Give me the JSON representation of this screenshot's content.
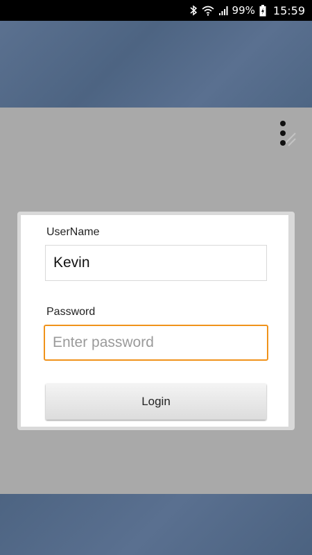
{
  "status_bar": {
    "battery": "99%",
    "time": "15:59",
    "icons": [
      "bluetooth-icon",
      "wifi-icon",
      "signal-icon",
      "battery-charging-icon"
    ]
  },
  "menu": {
    "icon": "overflow-menu-icon"
  },
  "login_form": {
    "username_label": "UserName",
    "username_value": "Kevin",
    "password_label": "Password",
    "password_value": "",
    "password_placeholder": "Enter password",
    "login_button": "Login"
  },
  "colors": {
    "focus_border": "#f0921a",
    "overlay": "#a9a9a9",
    "background_image": "#54698a"
  }
}
